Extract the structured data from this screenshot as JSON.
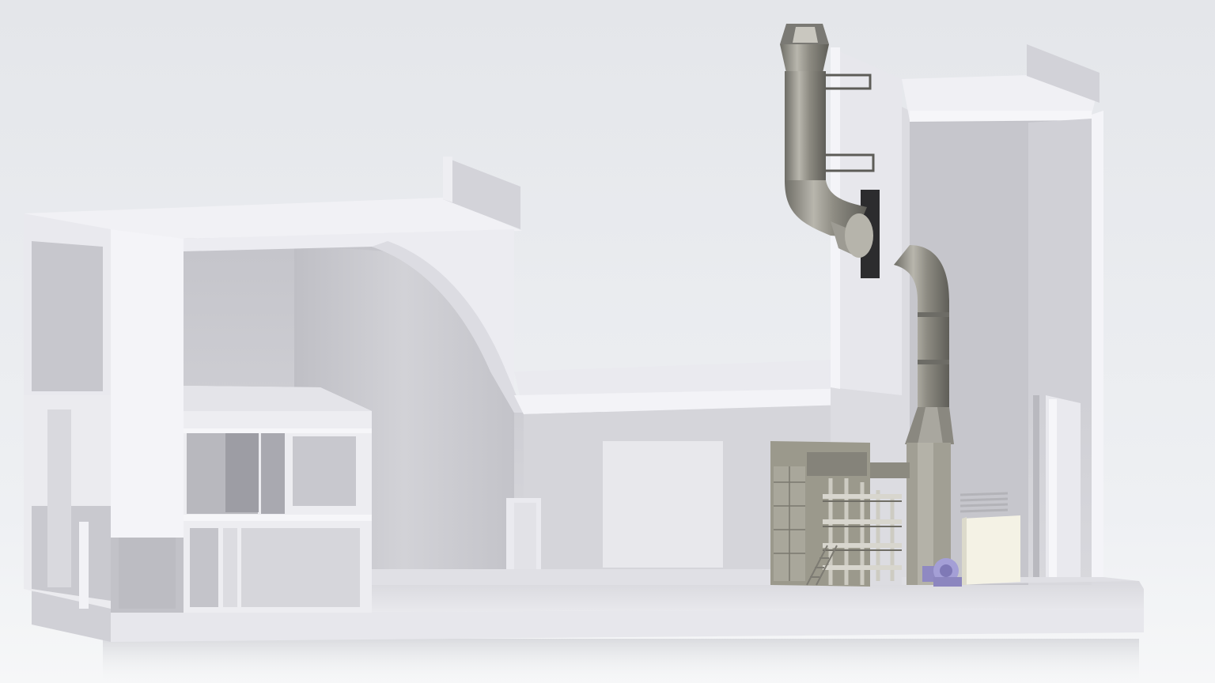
{
  "scene": {
    "subject": "building-cutaway-render",
    "colors": {
      "background_top": "#e6e8ec",
      "background_bottom": "#f3f4f6",
      "wall_face": "#eeeef2",
      "wall_shadow": "#b9b9bf",
      "interior": "#c9c9ce",
      "floor": "#e3e3e8",
      "pipe": "#8a8a82",
      "equipment": "#9d9b8c",
      "fan": "#9a95c9",
      "cabinet": "#f3f1e4"
    },
    "icons": [
      "exhaust-stack-icon",
      "boiler-unit-icon",
      "fan-icon",
      "electrical-cabinet-icon"
    ]
  }
}
